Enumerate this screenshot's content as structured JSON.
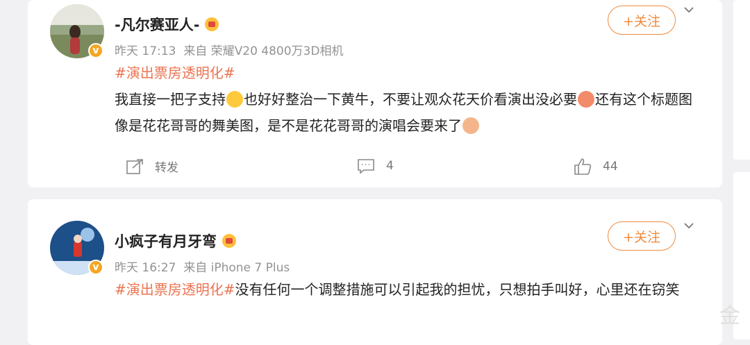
{
  "posts": [
    {
      "username": "-凡尔赛亚人-",
      "timestamp": "昨天 17:13",
      "source": "来自 荣耀V20 4800万3D相机",
      "follow_label": "+关注",
      "hashtag": "#演出票房透明化#",
      "text_part1": "我直接一把子支持",
      "text_part2": "也好好整治一下黄牛，不要让观众花天价看演出没必要",
      "text_part3": "还有这个标题图像是花花哥哥的舞美图，是不是花花哥哥的演唱会要来了",
      "actions": {
        "repost": "转发",
        "comments": "4",
        "likes": "44"
      }
    },
    {
      "username": "小疯子有月牙弯",
      "timestamp": "昨天 16:27",
      "source": "来自 iPhone 7 Plus",
      "follow_label": "+关注",
      "hashtag": "#演出票房透明化#",
      "text": "没有任何一个调整措施可以引起我的担忧，只想拍手叫好，心里还在窃笑"
    }
  ],
  "colors": {
    "accent": "#eb7350",
    "follow": "#f08a3c",
    "vip": "#f5a623"
  },
  "icons": [
    "verified-badge-icon",
    "vip-crown-icon",
    "chevron-down-icon",
    "repost-icon",
    "comment-icon",
    "like-icon"
  ]
}
